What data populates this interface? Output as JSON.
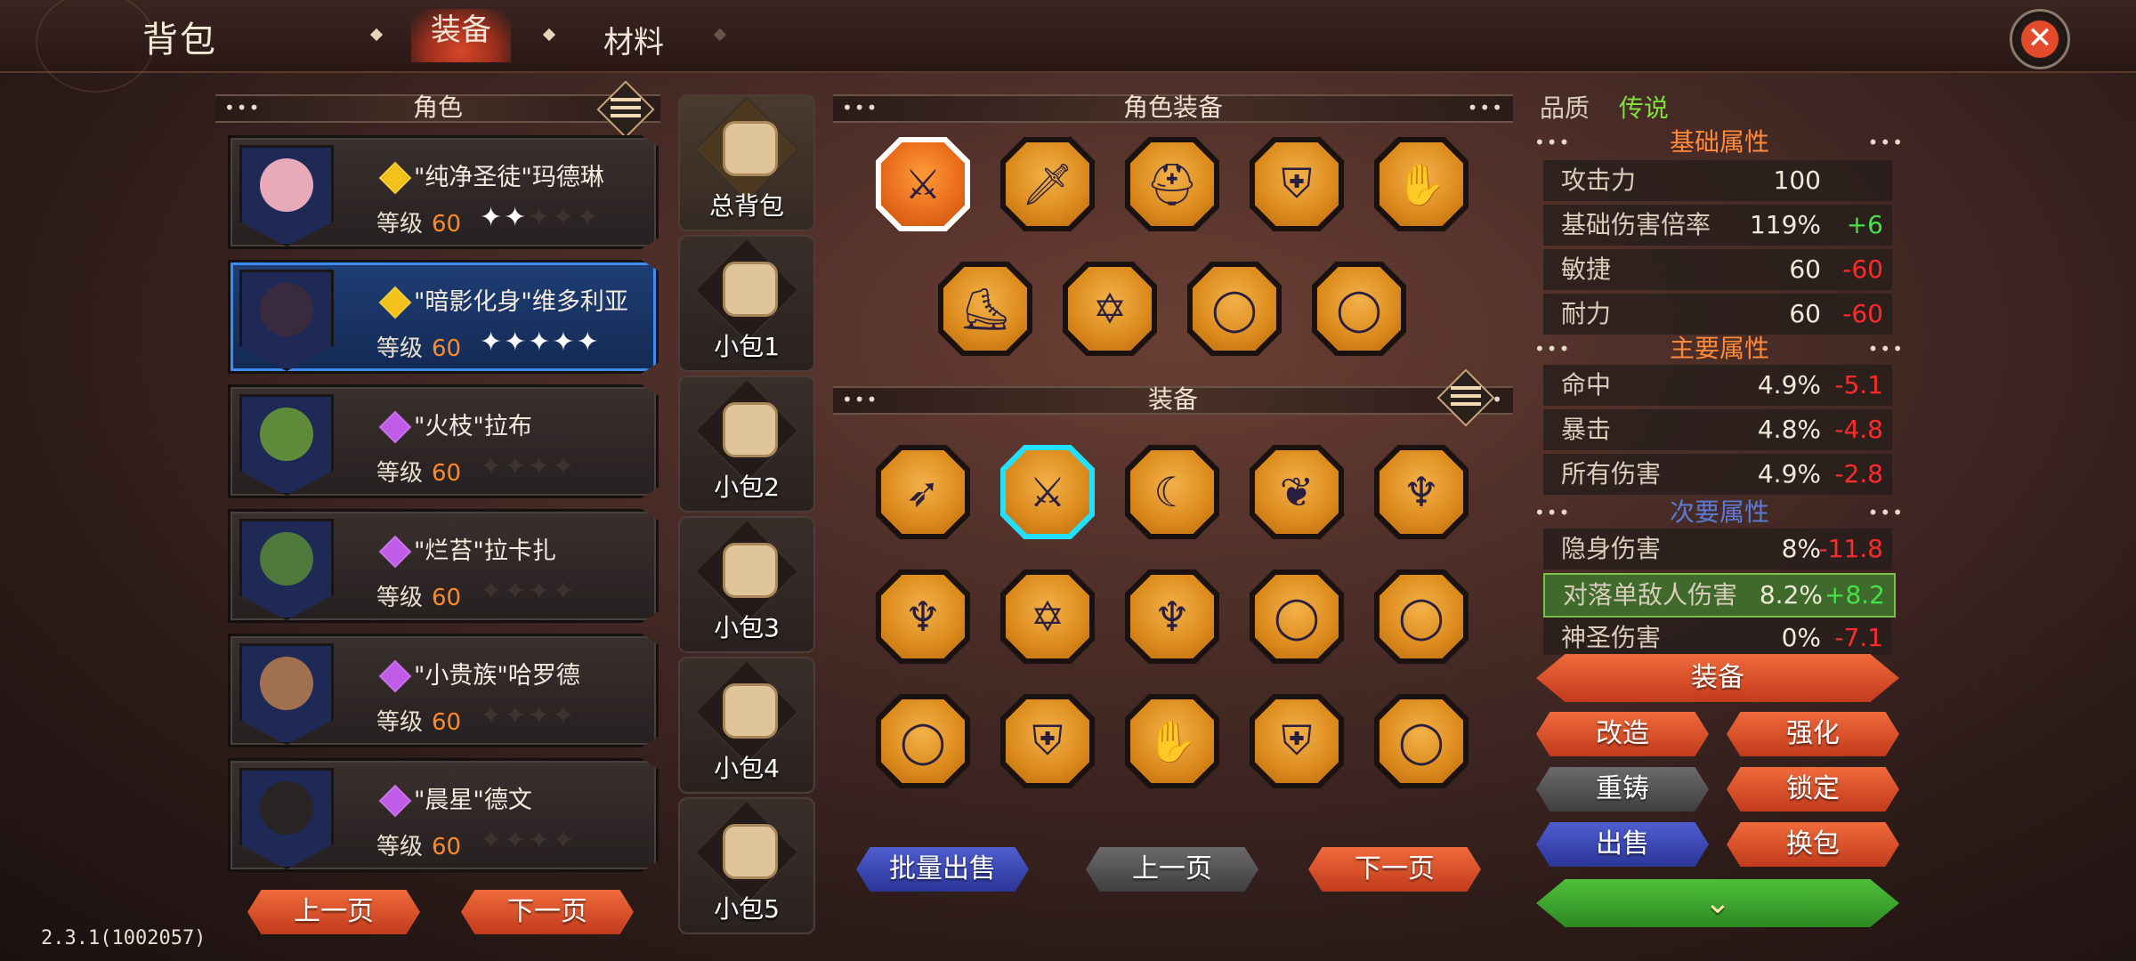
{
  "header": {
    "title": "背包",
    "tabs": [
      {
        "label": "装备",
        "active": true
      },
      {
        "label": "材料",
        "active": false
      }
    ]
  },
  "characters": {
    "header": "角色",
    "items": [
      {
        "name": "\"纯净圣徒\"玛德琳",
        "level_label": "等级",
        "level": "60",
        "stars": 2,
        "gem_color": "#f2c21a"
      },
      {
        "name": "\"暗影化身\"维多利亚",
        "level_label": "等级",
        "level": "60",
        "stars": 5,
        "gem_color": "#f2c21a",
        "selected": true
      },
      {
        "name": "\"火枝\"拉布",
        "level_label": "等级",
        "level": "60",
        "stars": 0,
        "gem_color": "#c05ce8"
      },
      {
        "name": "\"烂苔\"拉卡扎",
        "level_label": "等级",
        "level": "60",
        "stars": 0,
        "gem_color": "#c05ce8"
      },
      {
        "name": "\"小贵族\"哈罗德",
        "level_label": "等级",
        "level": "60",
        "stars": 0,
        "gem_color": "#c05ce8"
      },
      {
        "name": "\"晨星\"德文",
        "level_label": "等级",
        "level": "60",
        "stars": 0,
        "gem_color": "#c05ce8"
      }
    ],
    "prev_page": "上一页",
    "next_page": "下一页"
  },
  "bags": [
    {
      "label": "总背包"
    },
    {
      "label": "小包1"
    },
    {
      "label": "小包2"
    },
    {
      "label": "小包3"
    },
    {
      "label": "小包4"
    },
    {
      "label": "小包5"
    }
  ],
  "character_equipment": {
    "header": "角色装备",
    "items": [
      "sword-icon",
      "dagger-icon",
      "helmet-icon",
      "armor-icon",
      "gauntlets-icon",
      "boots-icon",
      "hexagram-amulet-icon",
      "ring-icon",
      "ring-icon"
    ]
  },
  "equipment": {
    "header": "装备",
    "items": [
      "spear-icon",
      "sword-icon",
      "scythe-icon",
      "wings-icon",
      "pendant-icon",
      "pendant-icon",
      "hexagram-amulet-icon",
      "pendant-icon",
      "ring-icon",
      "ring-icon",
      "ring-icon",
      "armor-icon",
      "gauntlets-icon",
      "armor-icon",
      "ring-icon"
    ],
    "batch_sell": "批量出售",
    "prev_page": "上一页",
    "next_page": "下一页"
  },
  "stats": {
    "quality_label": "品质",
    "quality_value": "传说",
    "quality_color": "#7de03c",
    "basic_header": "基础属性",
    "basic": [
      {
        "name": "攻击力",
        "value": "100",
        "delta": ""
      },
      {
        "name": "基础伤害倍率",
        "value": "119%",
        "delta": "+6",
        "delta_type": "green"
      },
      {
        "name": "敏捷",
        "value": "60",
        "delta": "-60",
        "delta_type": "red"
      },
      {
        "name": "耐力",
        "value": "60",
        "delta": "-60",
        "delta_type": "red"
      }
    ],
    "main_header": "主要属性",
    "main": [
      {
        "name": "命中",
        "value": "4.9%",
        "delta": "-5.1",
        "delta_type": "red"
      },
      {
        "name": "暴击",
        "value": "4.8%",
        "delta": "-4.8",
        "delta_type": "red"
      },
      {
        "name": "所有伤害",
        "value": "4.9%",
        "delta": "-2.8",
        "delta_type": "red"
      }
    ],
    "secondary_header": "次要属性",
    "secondary": [
      {
        "name": "隐身伤害",
        "value": "8%",
        "delta": "-11.8",
        "delta_type": "red"
      },
      {
        "name": "对落单敌人伤害",
        "value": "8.2%",
        "delta": "+8.2",
        "delta_type": "green",
        "highlight": true
      },
      {
        "name": "神圣伤害",
        "value": "0%",
        "delta": "-7.1",
        "delta_type": "red"
      }
    ]
  },
  "actions": {
    "equip": "装备",
    "reforge": "改造",
    "enhance": "强化",
    "recast": "重铸",
    "lock": "锁定",
    "sell": "出售",
    "swap_bag": "换包"
  },
  "version": "2.3.1(1002057)"
}
